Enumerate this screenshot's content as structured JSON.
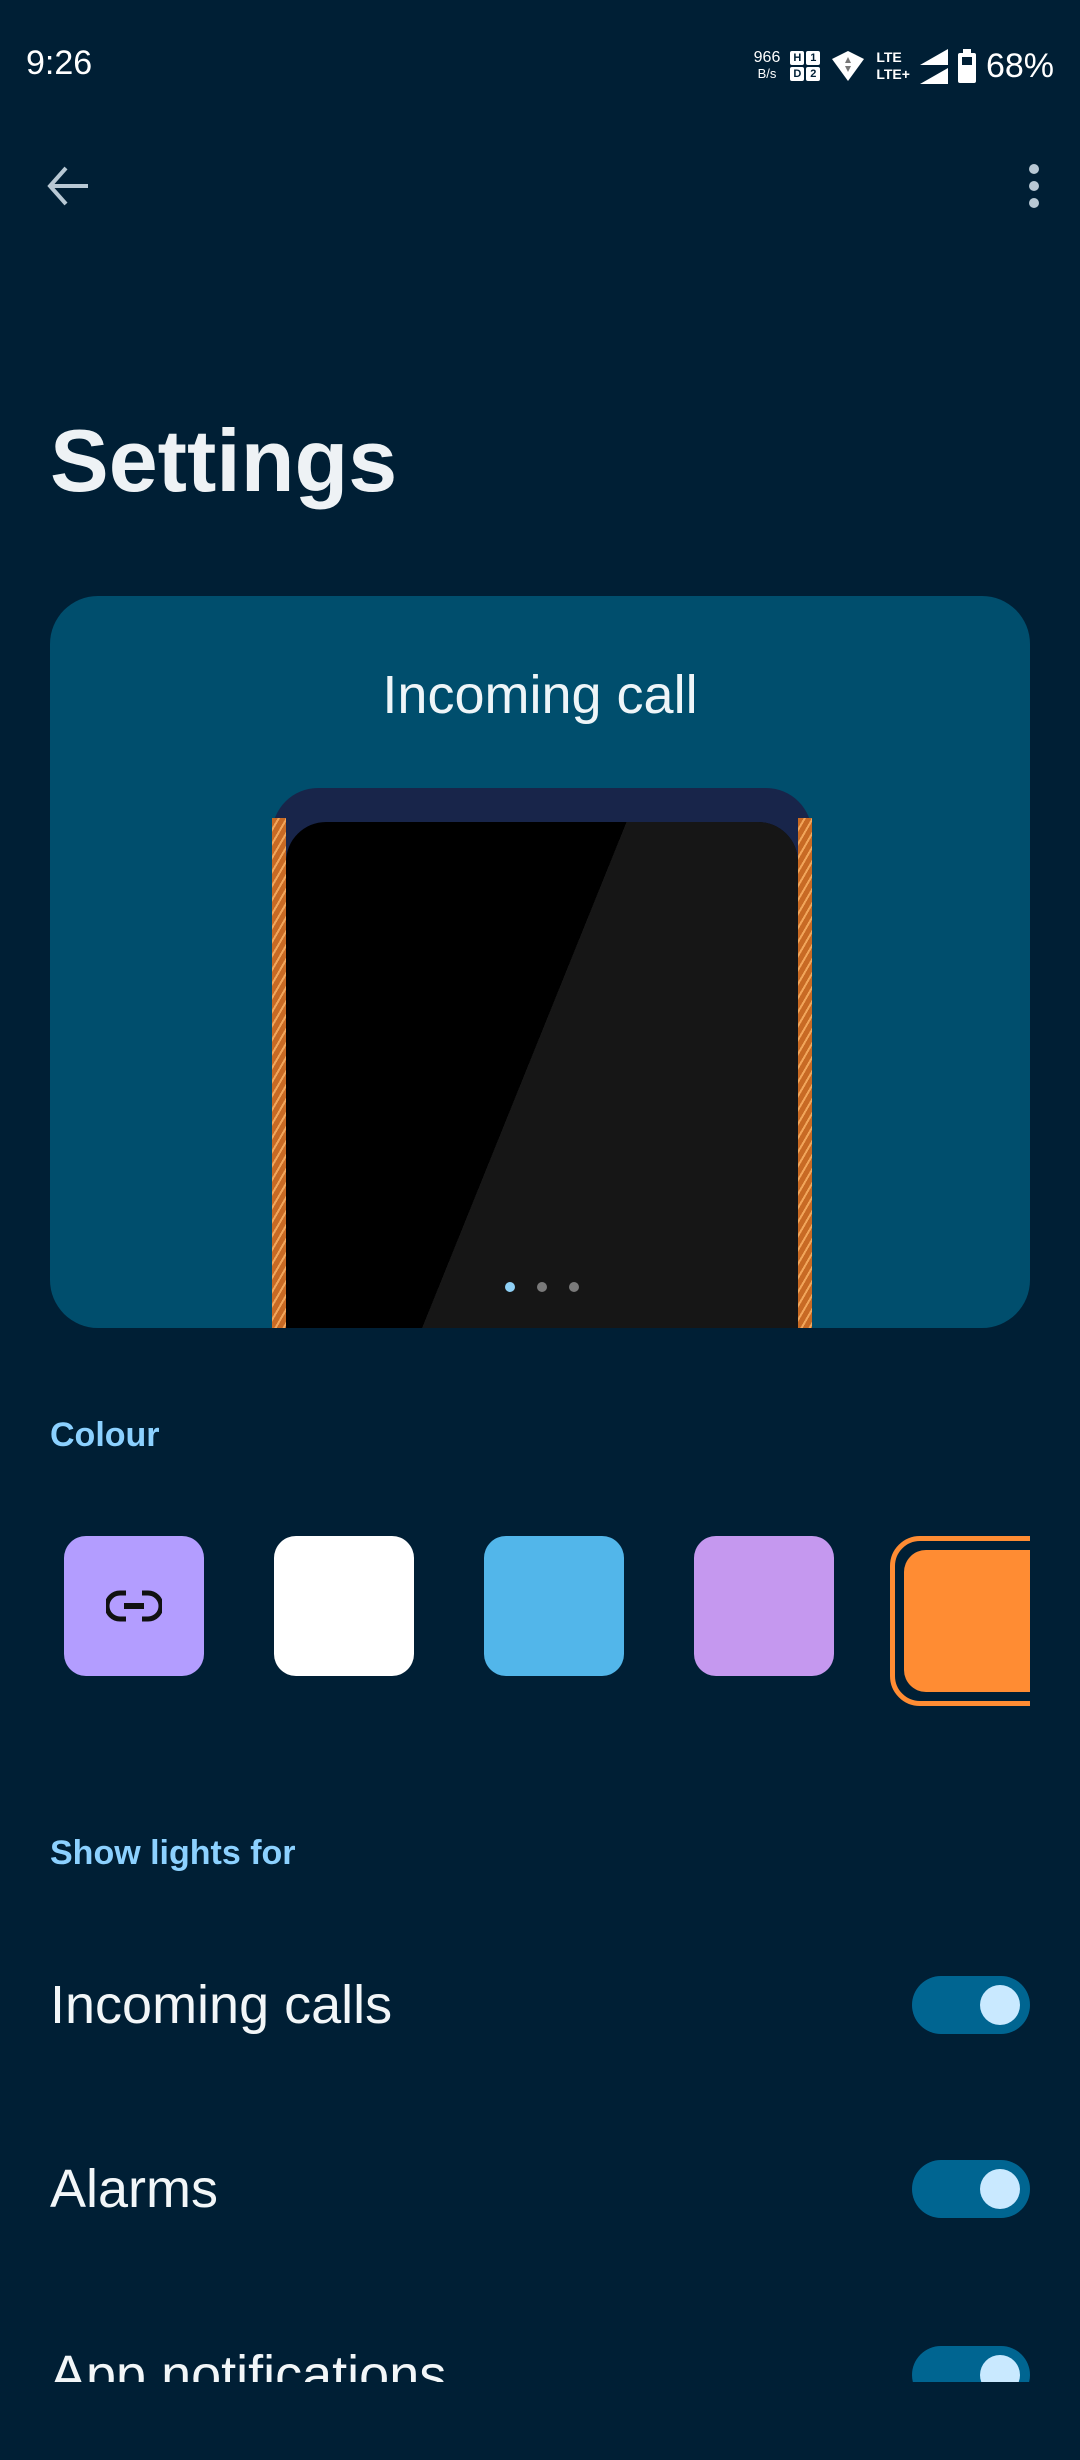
{
  "status_bar": {
    "time": "9:26",
    "net_speed_value": "966",
    "net_speed_unit": "B/s",
    "hd_labels": [
      "H",
      "1",
      "D",
      "2"
    ],
    "lte_top": "LTE",
    "lte_bottom": "LTE+",
    "battery": "68%"
  },
  "toolbar": {
    "back_icon": "arrow-left-icon",
    "menu_icon": "more-vert-icon"
  },
  "page": {
    "title": "Settings"
  },
  "preview": {
    "label": "Incoming call",
    "pages": 3,
    "active_page": 1
  },
  "colour": {
    "heading": "Colour",
    "swatches": [
      {
        "name": "linked",
        "color": "#b39dff",
        "icon": "link-icon"
      },
      {
        "name": "white",
        "color": "#ffffff"
      },
      {
        "name": "blue",
        "color": "#52b6ea"
      },
      {
        "name": "purple",
        "color": "#c598ef"
      },
      {
        "name": "orange",
        "color": "#ff8c33",
        "selected": true
      }
    ]
  },
  "show_lights": {
    "heading": "Show lights for",
    "items": [
      {
        "label": "Incoming calls",
        "enabled": true
      },
      {
        "label": "Alarms",
        "enabled": true
      },
      {
        "label": "App notifications",
        "enabled": true
      }
    ]
  }
}
